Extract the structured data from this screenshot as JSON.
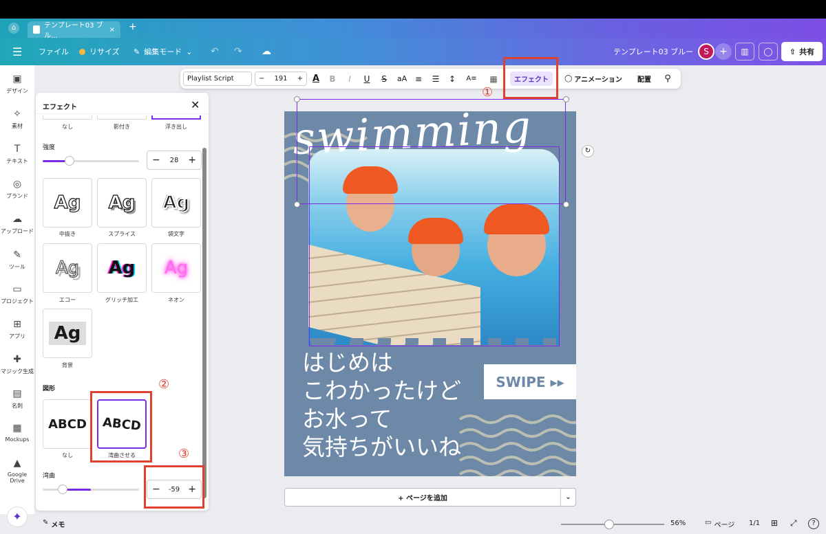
{
  "browser": {
    "tab_title": "テンプレート03 ブル…"
  },
  "menubar": {
    "file": "ファイル",
    "resize": "リサイズ",
    "edit_mode": "編集モード",
    "doc_title": "テンプレート03 ブルー",
    "avatar": "S",
    "share": "共有"
  },
  "toolbar": {
    "font": "Playlist Script",
    "font_size": "191",
    "effect": "エフェクト",
    "animation": "アニメーション",
    "position": "配置"
  },
  "rail": [
    {
      "label": "デザイン",
      "icon": "design-icon"
    },
    {
      "label": "素材",
      "icon": "elements-icon"
    },
    {
      "label": "テキスト",
      "icon": "text-icon"
    },
    {
      "label": "ブランド",
      "icon": "brand-icon"
    },
    {
      "label": "アップロード",
      "icon": "upload-icon"
    },
    {
      "label": "ツール",
      "icon": "tools-icon"
    },
    {
      "label": "プロジェクト",
      "icon": "folder-icon"
    },
    {
      "label": "アプリ",
      "icon": "apps-icon"
    },
    {
      "label": "マジック生成",
      "icon": "magic-icon"
    },
    {
      "label": "名刺",
      "icon": "card-icon"
    },
    {
      "label": "Mockups",
      "icon": "mockups-icon"
    },
    {
      "label": "Google Drive",
      "icon": "drive-icon"
    }
  ],
  "panel": {
    "title": "エフェクト",
    "top_labels": [
      "なし",
      "影付き",
      "浮き出し"
    ],
    "intensity_label": "強度",
    "intensity_value": "28",
    "intensity_level": 0.28,
    "effects": [
      {
        "label": "中抜き",
        "sample": "Ag"
      },
      {
        "label": "スプライス",
        "sample": "Ag"
      },
      {
        "label": "袋文字",
        "sample": "Ag"
      },
      {
        "label": "エコー",
        "sample": "Ag"
      },
      {
        "label": "グリッチ加工",
        "sample": "Ag"
      },
      {
        "label": "ネオン",
        "sample": "Ag"
      },
      {
        "label": "背景",
        "sample": "Ag"
      }
    ],
    "shape_label": "図形",
    "shapes": [
      {
        "label": "なし",
        "sample": "ABCD"
      },
      {
        "label": "湾曲させる",
        "sample": "ABCD"
      }
    ],
    "curve_label": "湾曲",
    "curve_value": "-59",
    "curve_level": 0.21
  },
  "canvas": {
    "title": "swimming",
    "swipe": "SWIPE ▸▸",
    "lines": [
      "はじめは",
      "こわかったけど",
      "お水って",
      "気持ちがいいね"
    ]
  },
  "annotations": [
    "①",
    "②",
    "③"
  ],
  "add_page": "+ ページを追加",
  "bottom": {
    "notes": "メモ",
    "zoom": "56%",
    "pages": "ページ",
    "page_count": "1/1"
  }
}
